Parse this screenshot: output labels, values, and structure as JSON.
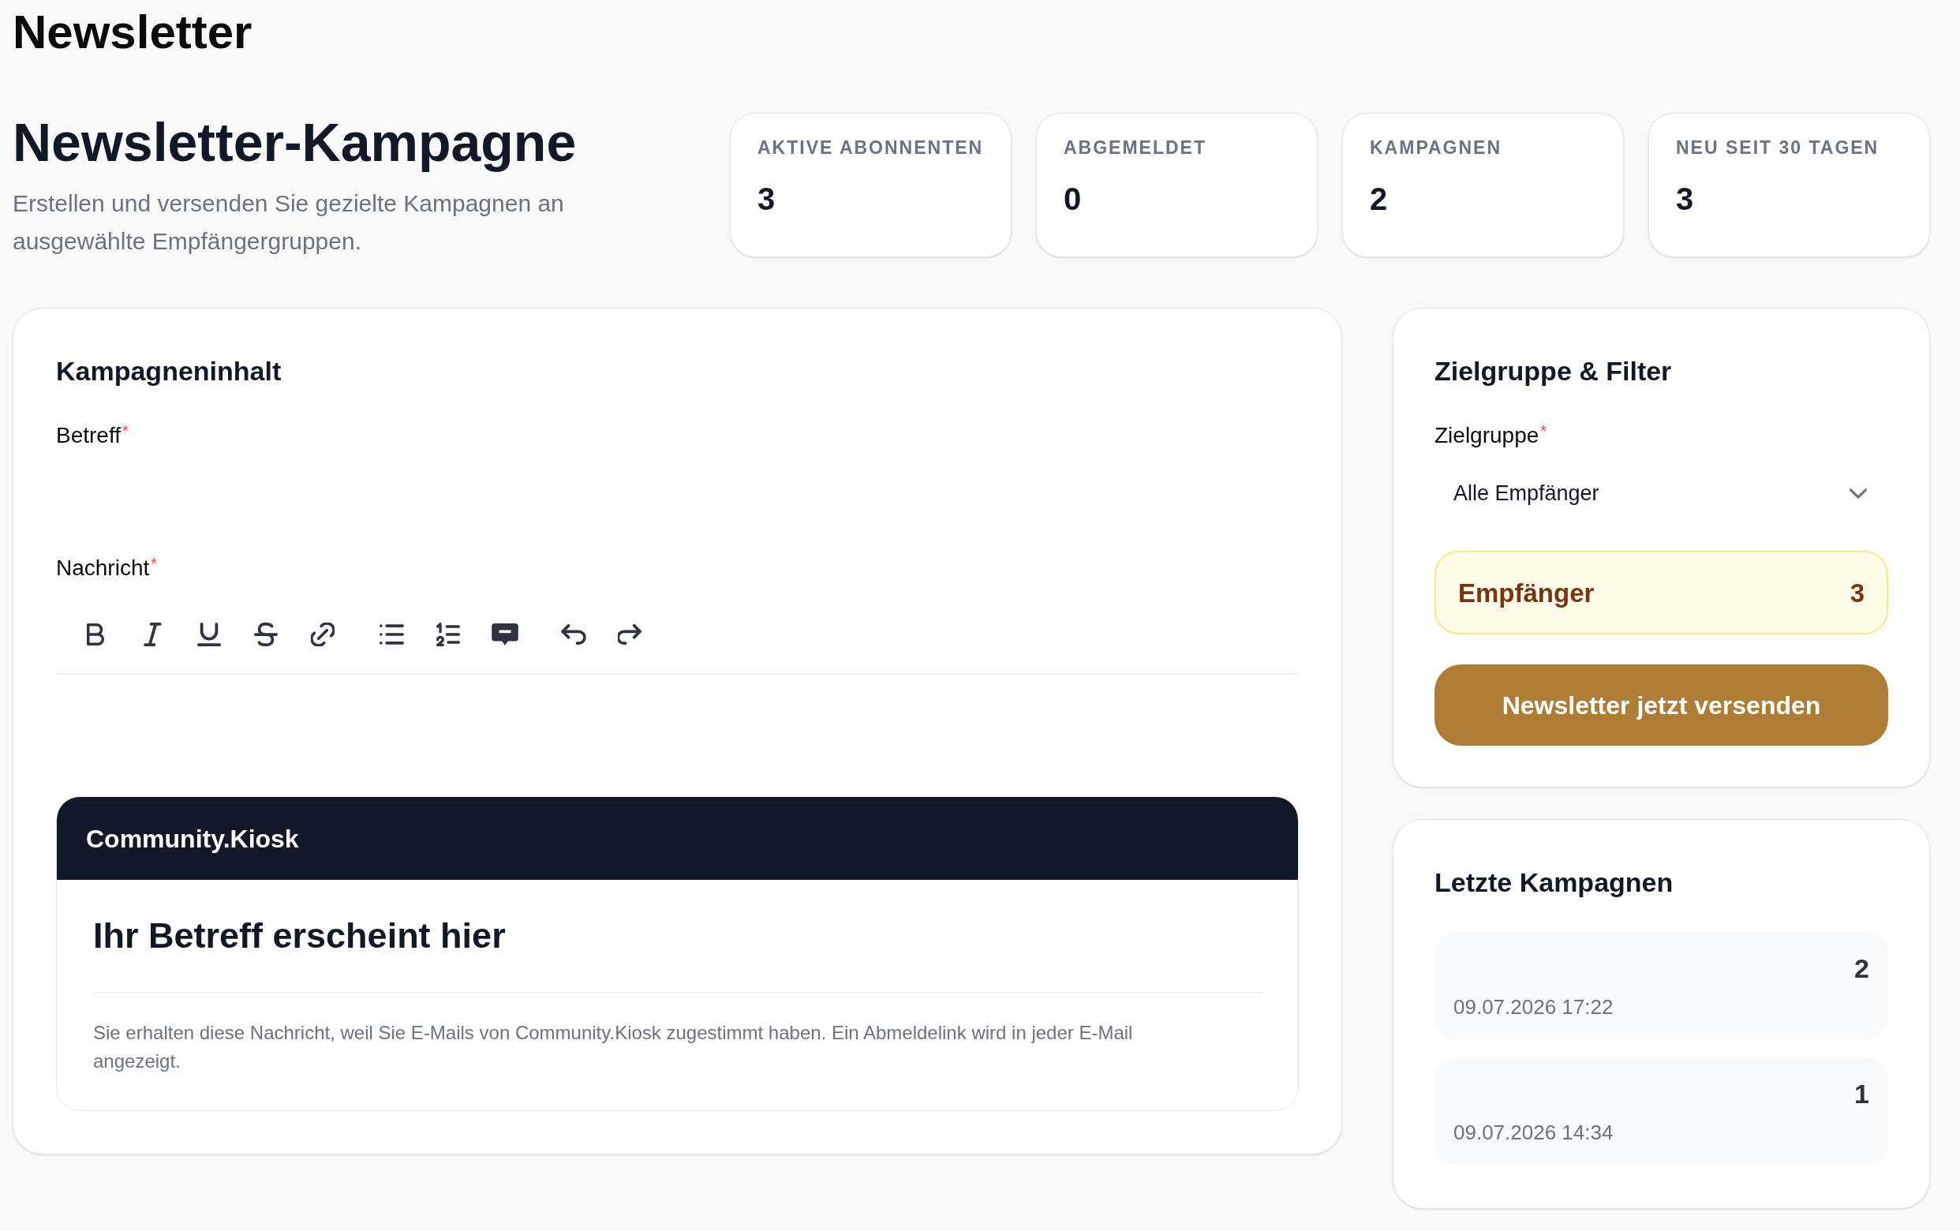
{
  "page_title": "Newsletter",
  "header": {
    "title": "Newsletter-Kampagne",
    "subtitle": "Erstellen und versenden Sie gezielte Kampagnen an ausgewählte Empfängergruppen."
  },
  "stats": [
    {
      "label": "AKTIVE ABONNENTEN",
      "value": "3"
    },
    {
      "label": "ABGEMELDET",
      "value": "0"
    },
    {
      "label": "KAMPAGNEN",
      "value": "2"
    },
    {
      "label": "NEU SEIT 30 TAGEN",
      "value": "3"
    }
  ],
  "content_panel": {
    "title": "Kampagneninhalt",
    "subject_field": {
      "label": "Betreff",
      "required_mark": "*"
    },
    "message_field": {
      "label": "Nachricht",
      "required_mark": "*"
    },
    "preview": {
      "brand": "Community.Kiosk",
      "subject": "Ihr Betreff erscheint hier",
      "footer": "Sie erhalten diese Nachricht, weil Sie E-Mails von Community.Kiosk zugestimmt haben. Ein Abmeldelink wird in jeder E-Mail angezeigt."
    }
  },
  "audience_panel": {
    "title": "Zielgruppe & Filter",
    "audience_field": {
      "label": "Zielgruppe",
      "required_mark": "*",
      "value": "Alle Empfänger"
    },
    "recipients": {
      "label": "Empfänger",
      "count": "3"
    },
    "send_button": "Newsletter jetzt versenden"
  },
  "recent_panel": {
    "title": "Letzte Kampagnen",
    "campaigns": [
      {
        "number": "2",
        "date": "09.07.2026 17:22"
      },
      {
        "number": "1",
        "date": "09.07.2026 14:34"
      }
    ]
  }
}
